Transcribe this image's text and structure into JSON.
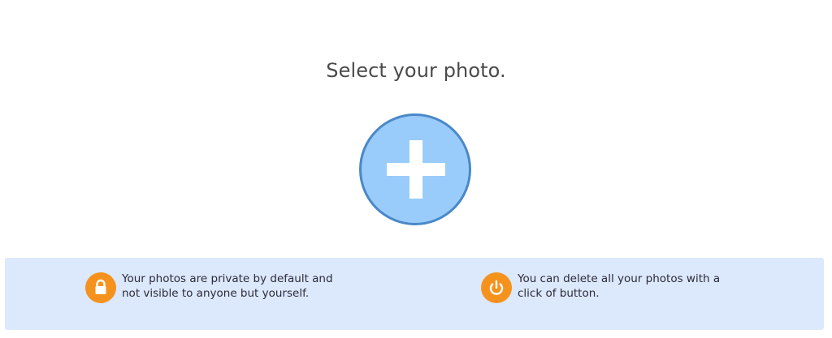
{
  "page": {
    "title": "Select your photo."
  },
  "upload": {
    "icon": "plus-icon",
    "fill_color": "#99ccfa",
    "border_color": "#4a88c8"
  },
  "info": {
    "privacy": {
      "icon": "lock-icon",
      "text": "Your photos are private by default and not visible to anyone but yourself."
    },
    "delete": {
      "icon": "power-icon",
      "text": "You can delete all your photos with a click of button."
    },
    "badge_color": "#f5921e",
    "bar_color": "#dce8fb"
  }
}
